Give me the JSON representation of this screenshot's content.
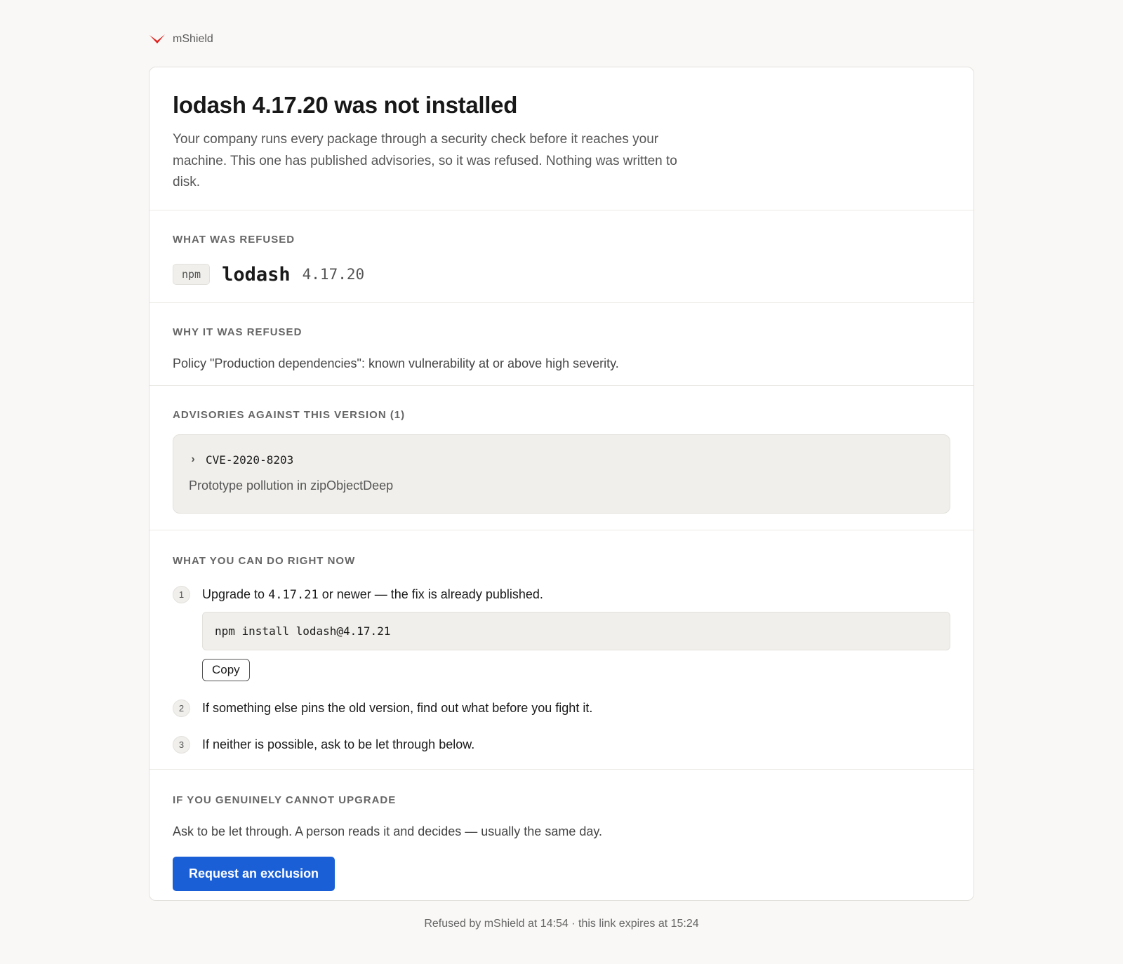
{
  "brand": {
    "name": "mShield",
    "logo_icon": "chevron-v-logo-icon",
    "logo_color": "#e0201c"
  },
  "header": {
    "title": "lodash 4.17.20 was not installed",
    "lead": "Your company runs every package through a security check before it reaches your machine. This one has published advisories, so it was refused. Nothing was written to disk."
  },
  "refused": {
    "label": "WHAT WAS REFUSED",
    "ecosystem": "npm",
    "package": "lodash",
    "version": "4.17.20"
  },
  "reason": {
    "label": "WHY IT WAS REFUSED",
    "text": "Policy \"Production dependencies\": known vulnerability at or above high severity."
  },
  "advisories": {
    "label": "ADVISORIES AGAINST THIS VERSION (1)",
    "items": [
      {
        "id": "CVE-2020-8203",
        "description": "Prototype pollution in zipObjectDeep"
      }
    ]
  },
  "actions": {
    "label": "WHAT YOU CAN DO RIGHT NOW",
    "steps": [
      {
        "number": "1",
        "text_before": "Upgrade to ",
        "version": "4.17.21",
        "text_after": " or newer — the fix is already published.",
        "command": "npm install lodash@4.17.21",
        "copy_label": "Copy"
      },
      {
        "number": "2",
        "text": "If something else pins the old version, find out what before you fight it."
      },
      {
        "number": "3",
        "text": "If neither is possible, ask to be let through below."
      }
    ]
  },
  "exclusion": {
    "label": "IF YOU GENUINELY CANNOT UPGRADE",
    "text": "Ask to be let through. A person reads it and decides — usually the same day.",
    "button_label": "Request an exclusion",
    "button_color": "#1a5fd6"
  },
  "footer": {
    "text": "Refused by mShield at 14:54 · this link expires at 15:24"
  }
}
